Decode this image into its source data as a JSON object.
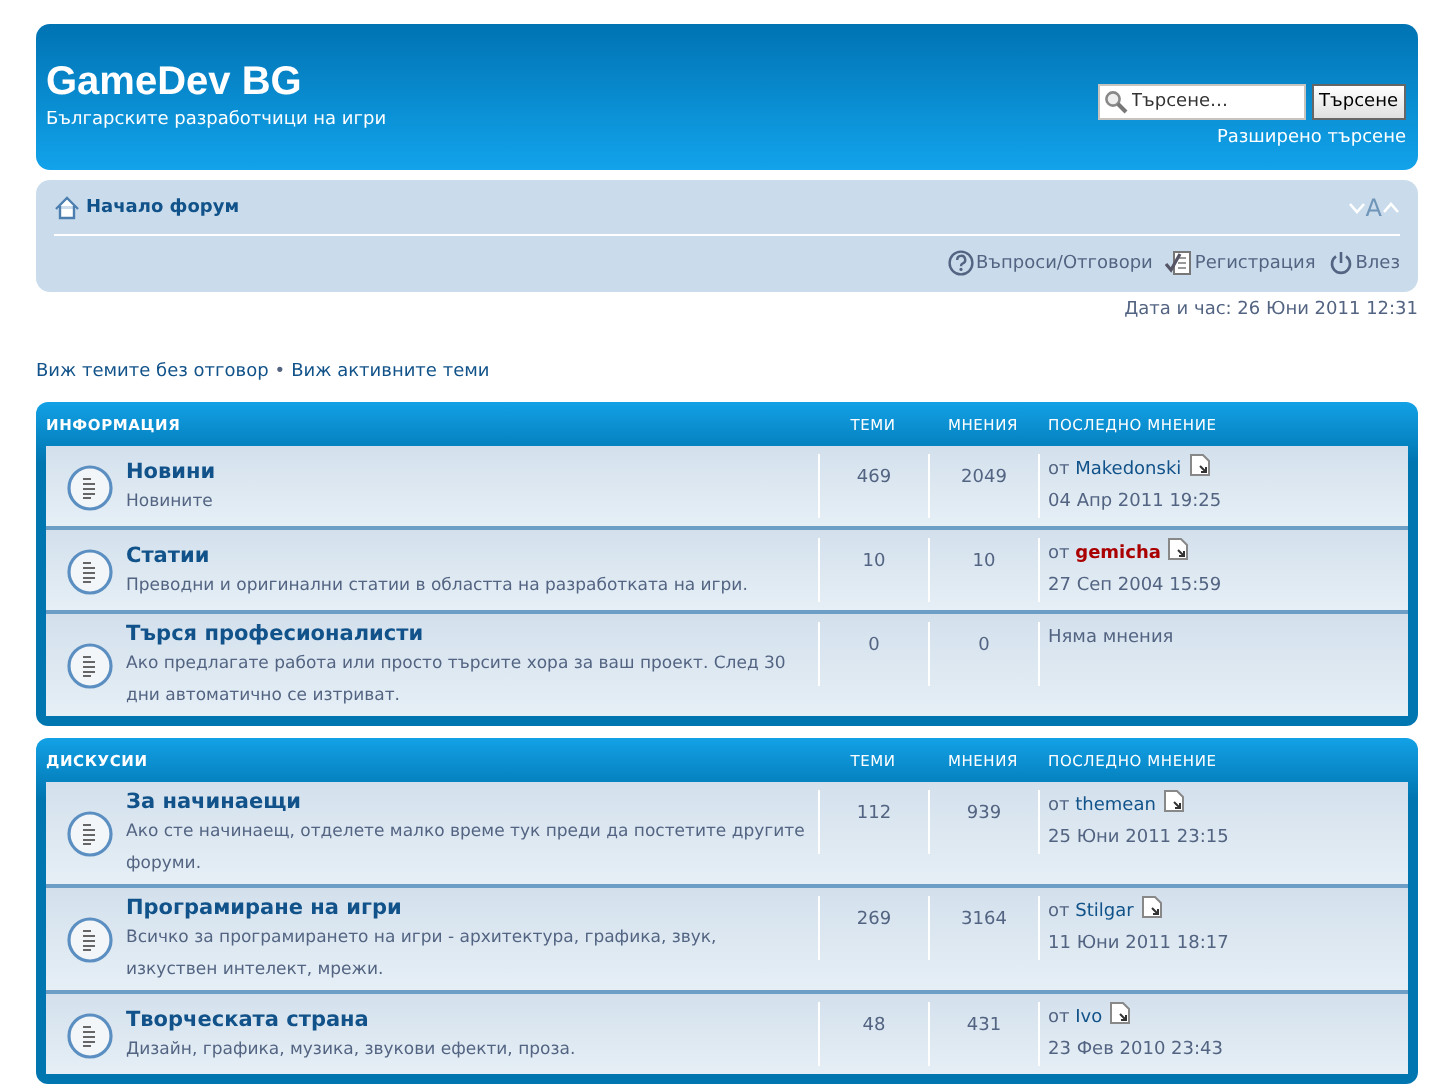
{
  "header": {
    "site_title": "GameDev BG",
    "site_description": "Българските разработчици на игри",
    "search": {
      "placeholder": "Търсене…",
      "button": "Търсене"
    },
    "advanced_search": "Разширено търсене"
  },
  "navbar": {
    "breadcrumb": "Начало форум",
    "font_size_control": "A",
    "links": [
      {
        "label": "Въпроси/Отговори",
        "kind": "faq"
      },
      {
        "label": "Регистрация",
        "kind": "register"
      },
      {
        "label": "Влез",
        "kind": "login"
      }
    ]
  },
  "datetime": "Дата и час: 26 Юни 2011 12:31",
  "quick_links": [
    "Виж темите без отговор",
    "Виж активните теми"
  ],
  "quick_links_separator": "•",
  "categories": [
    {
      "name": "ИНФОРМАЦИЯ",
      "columns": [
        "ТЕМИ",
        "МНЕНИЯ",
        "ПОСЛЕДНО МНЕНИЕ"
      ],
      "forums": [
        {
          "title": "Новини",
          "description": "Новините",
          "topics": "469",
          "posts": "2049",
          "last_post": {
            "by": "от",
            "user": "Makedonski",
            "color": "#105289",
            "date": "04 Апр 2011 19:25"
          }
        },
        {
          "title": "Статии",
          "description": "Преводни и оригинални статии в областта на разработката на игри.",
          "topics": "10",
          "posts": "10",
          "last_post": {
            "by": "от",
            "user": "gemicha",
            "color": "#aa0000",
            "date": "27 Сеп 2004 15:59"
          }
        },
        {
          "title": "Търся професионалисти",
          "description": "Ако предлагате работа или просто търсите хора за ваш проект. След 30 дни автоматично се изтриват.",
          "topics": "0",
          "posts": "0",
          "no_posts": "Няма мнения"
        }
      ]
    },
    {
      "name": "ДИСКУСИИ",
      "columns": [
        "ТЕМИ",
        "МНЕНИЯ",
        "ПОСЛЕДНО МНЕНИЕ"
      ],
      "forums": [
        {
          "title": "За начинаещи",
          "description": "Ако сте начинаещ, отделете малко време тук преди да постетите другите форуми.",
          "topics": "112",
          "posts": "939",
          "last_post": {
            "by": "от",
            "user": "themean",
            "color": "#105289",
            "date": "25 Юни 2011 23:15"
          }
        },
        {
          "title": "Програмиране на игри",
          "description": "Всичко за програмирането на игри - архитектура, графика, звук, изкуствен интелект, мрежи.",
          "topics": "269",
          "posts": "3164",
          "last_post": {
            "by": "от",
            "user": "Stilgar",
            "color": "#105289",
            "date": "11 Юни 2011 18:17"
          }
        },
        {
          "title": "Творческата страна",
          "description": "Дизайн, графика, музика, звукови ефекти, проза.",
          "topics": "48",
          "posts": "431",
          "last_post": {
            "by": "от",
            "user": "Ivo",
            "color": "#105289",
            "date": "23 Фев 2010 23:43"
          }
        }
      ]
    }
  ]
}
